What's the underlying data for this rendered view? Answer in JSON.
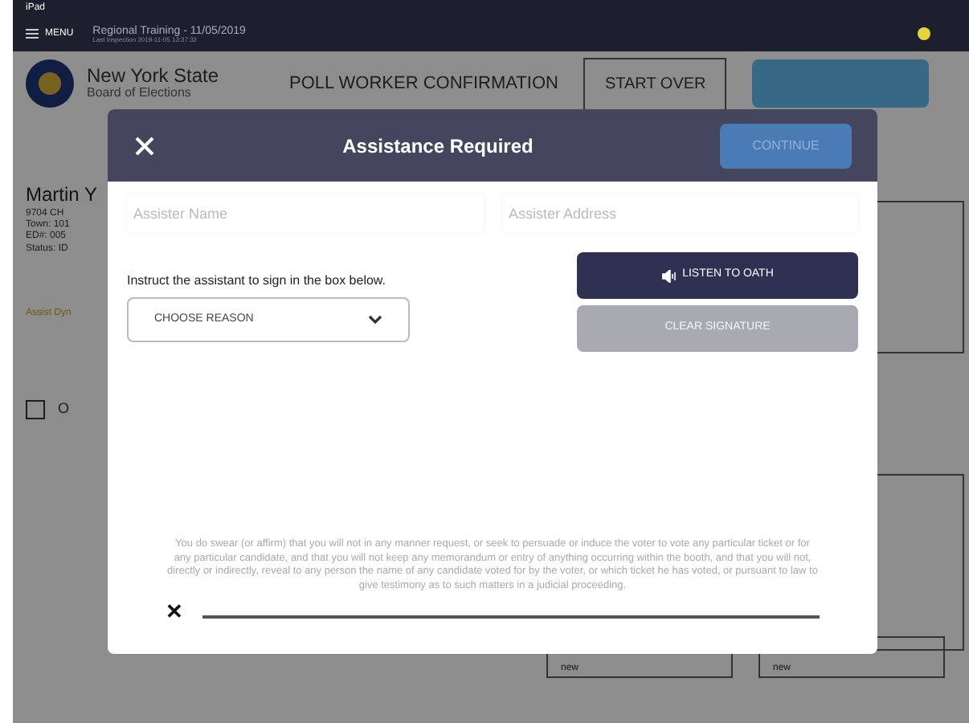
{
  "status_bar": {
    "carrier": "iPad"
  },
  "top_bar": {
    "menu_label": "MENU",
    "title": "Regional Training - 11/05/2019",
    "subtitle": "Last Inspection 2019-11-05 13:37:32"
  },
  "header": {
    "org_line1": "New York State",
    "org_line2": "Board of Elections",
    "tab_label": "POLL WORKER CONFIRMATION",
    "start_over": "START OVER"
  },
  "voter": {
    "name": "Martin Y",
    "lines": [
      "9704 CH",
      "Town: 101",
      "ED#: 005",
      "Status: ID"
    ],
    "section_label": "Assist Dyn",
    "option_label": "O",
    "option_checked": false,
    "fields": [
      "new",
      "new"
    ]
  },
  "modal": {
    "title": "Assistance Required",
    "continue": {
      "label": "CONTINUE",
      "disabled": true
    },
    "fields": [
      {
        "placeholder": "Assister Name"
      },
      {
        "placeholder": "Assister Address"
      }
    ],
    "instruction": "Instruct the assistant to sign in the box below.",
    "reason_select": "CHOOSE REASON",
    "buttons": [
      {
        "label": "LISTEN TO OATH",
        "disabled": false,
        "kind": "audio"
      },
      {
        "label": "CLEAR SIGNATURE",
        "disabled": true,
        "kind": "plain"
      }
    ],
    "oath": "You do swear (or affirm) that you will not in any manner request, or seek to persuade or induce the voter to vote any particular ticket or for any particular candidate, and that you will not keep any memorandum or entry of anything occurring within the booth, and that you will not, directly or indirectly, reveal to any person the name of any candidate voted for by the voter, or which ticket he has voted, or pursuant to law to give testimony as to such matters in a judicial proceeding.",
    "signature_mark": "✕"
  }
}
